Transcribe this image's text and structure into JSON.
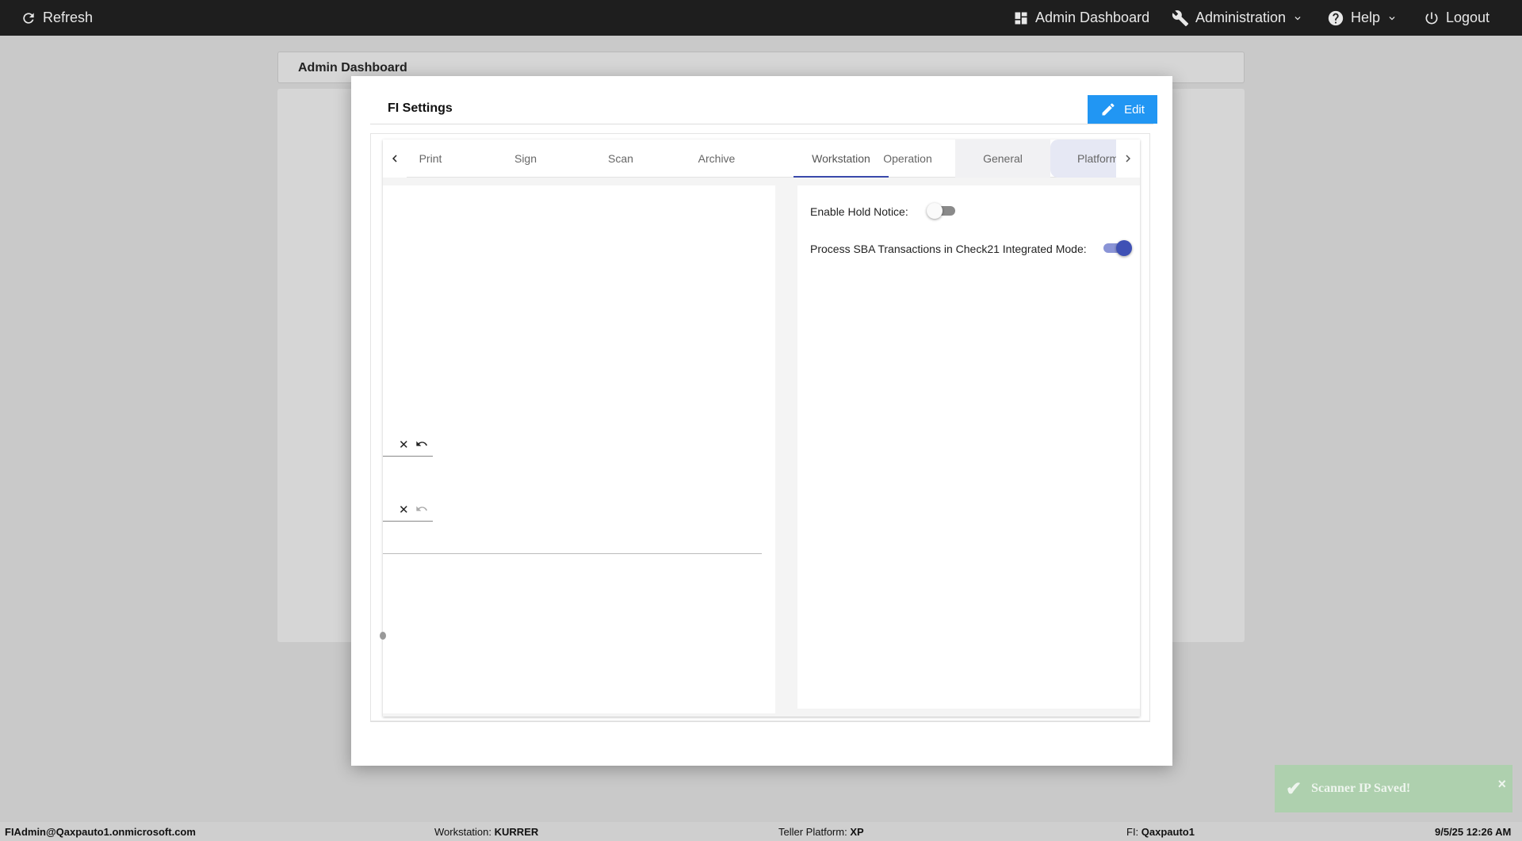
{
  "topbar": {
    "refresh_label": "Refresh",
    "admin_dashboard_label": "Admin Dashboard",
    "administration_label": "Administration",
    "help_label": "Help",
    "logout_label": "Logout"
  },
  "background": {
    "page_title": "Admin Dashboard"
  },
  "modal": {
    "title": "FI Settings",
    "edit_label": "Edit",
    "tabs": [
      {
        "label": "Print"
      },
      {
        "label": "Sign"
      },
      {
        "label": "Scan"
      },
      {
        "label": "Archive"
      },
      {
        "label": "Workstation"
      },
      {
        "label": "Operation"
      },
      {
        "label": "General"
      },
      {
        "label": "Platform"
      }
    ],
    "active_tab": "Workstation",
    "settings": [
      {
        "label": "Enable Hold Notice:",
        "enabled": false
      },
      {
        "label": "Process SBA Transactions in Check21 Integrated Mode:",
        "enabled": true
      }
    ]
  },
  "toast": {
    "message": "Scanner IP Saved!",
    "close_glyph": "×",
    "color": "#aed0ae"
  },
  "statusbar": {
    "user": "FIAdmin@Qaxpauto1.onmicrosoft.com",
    "workstation_label": "Workstation:",
    "workstation_value": "KURRER",
    "platform_label": "Teller Platform:",
    "platform_value": "XP",
    "fi_label": "FI:",
    "fi_value": "Qaxpauto1",
    "datetime": "9/5/25 12:26 AM"
  },
  "colors": {
    "primary": "#2196f3",
    "tab_indicator": "#3949ab",
    "toggle_on": "#3f51b5",
    "topbar": "#1e1e1e"
  }
}
